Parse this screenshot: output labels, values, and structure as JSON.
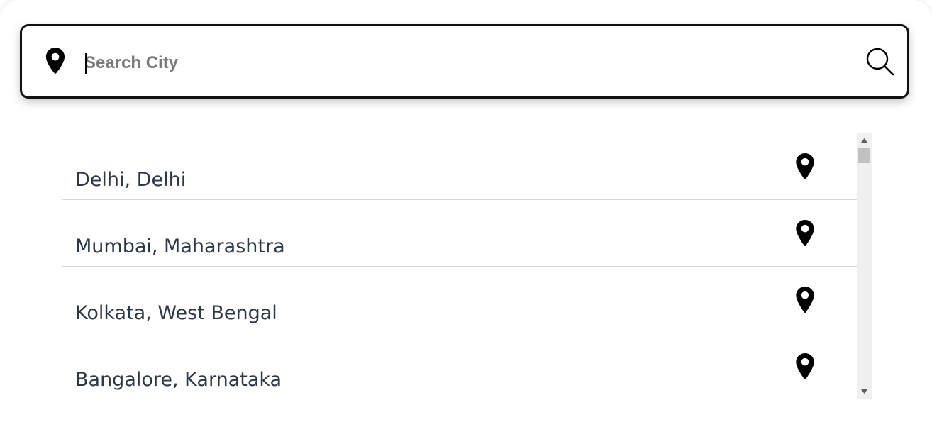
{
  "search": {
    "placeholder": "Search City",
    "value": "",
    "location_icon": "map-pin-icon",
    "search_icon": "magnifier-icon"
  },
  "results": [
    {
      "label": "Delhi, Delhi",
      "icon": "map-pin-icon"
    },
    {
      "label": "Mumbai, Maharashtra",
      "icon": "map-pin-icon"
    },
    {
      "label": "Kolkata, West Bengal",
      "icon": "map-pin-icon"
    },
    {
      "label": "Bangalore, Karnataka",
      "icon": "map-pin-icon"
    }
  ],
  "colors": {
    "text": "#2c3848",
    "border": "#111111",
    "placeholder": "#7a7a7a",
    "divider": "#d6d6d6",
    "scrollbar_track": "#f0f0f0",
    "scrollbar_thumb": "#c1c1c1"
  }
}
